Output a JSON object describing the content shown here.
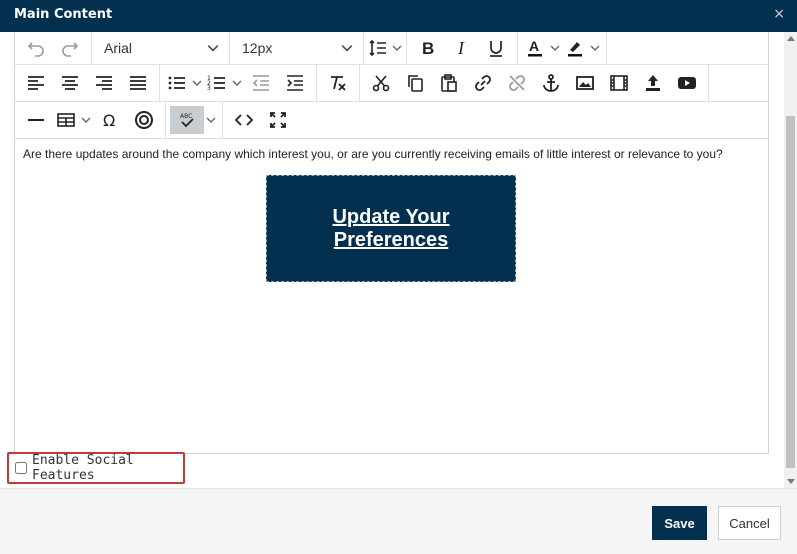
{
  "dialog": {
    "title": "Main Content",
    "close_glyph": "×"
  },
  "toolbar": {
    "font_family": "Arial",
    "font_size": "12px",
    "icons": {
      "undo": "undo-icon",
      "redo": "redo-icon",
      "line_height": "line-height-icon",
      "bold": "bold-icon",
      "italic": "italic-icon",
      "underline": "underline-icon",
      "text_color": "text-color-icon",
      "highlight": "highlight-color-icon",
      "align_left": "align-left-icon",
      "align_center": "align-center-icon",
      "align_right": "align-right-icon",
      "justify": "justify-icon",
      "bullet_list": "bullet-list-icon",
      "numbered_list": "numbered-list-icon",
      "outdent": "outdent-icon",
      "indent": "indent-icon",
      "clear_format": "clear-formatting-icon",
      "cut": "cut-icon",
      "copy": "copy-icon",
      "paste": "paste-icon",
      "link": "link-icon",
      "unlink": "unlink-icon",
      "anchor": "anchor-icon",
      "image": "image-icon",
      "video": "video-icon",
      "upload": "upload-icon",
      "youtube": "youtube-icon",
      "hr": "horizontal-rule-icon",
      "table": "table-icon",
      "special_char": "omega-icon",
      "target": "target-icon",
      "spellcheck": "spellcheck-icon",
      "code": "code-view-icon",
      "fullscreen": "fullscreen-icon"
    }
  },
  "content": {
    "paragraph": "Are there updates around the company which interest you, or are you currently receiving emails of little interest or relevance to you?",
    "cta_label": "Update Your Preferences"
  },
  "social": {
    "label": "Enable Social Features",
    "checked": false
  },
  "footer": {
    "save_label": "Save",
    "cancel_label": "Cancel"
  },
  "colors": {
    "brand": "#03304f",
    "highlight_border": "#c0393b"
  }
}
